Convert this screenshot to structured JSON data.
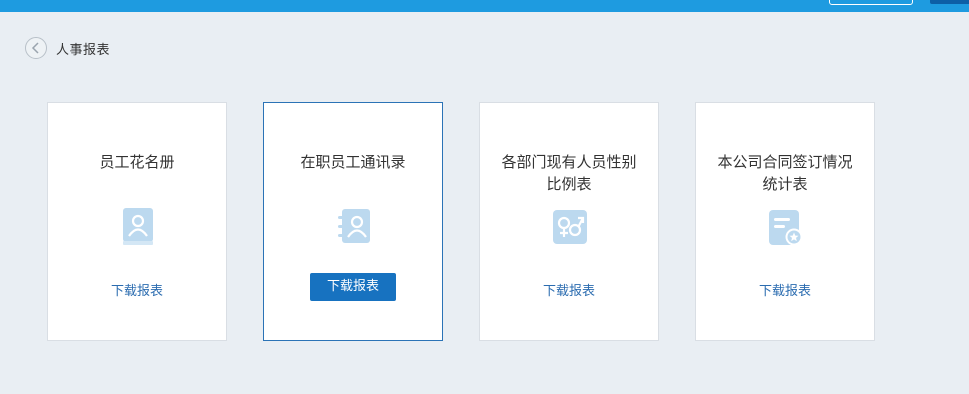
{
  "breadcrumb": {
    "title": "人事报表",
    "back_icon": "back-circle-icon"
  },
  "colors": {
    "topbar": "#1e9be0",
    "accent": "#1772c0",
    "link": "#2b6cb0",
    "icon": "#bcd9ef"
  },
  "cards": [
    {
      "title": "员工花名册",
      "icon": "contact-book-icon",
      "action": "下载报表",
      "selected": false
    },
    {
      "title": "在职员工通讯录",
      "icon": "address-book-icon",
      "action": "下载报表",
      "selected": true
    },
    {
      "title": "各部门现有人员性别比例表",
      "icon": "gender-ratio-icon",
      "action": "下载报表",
      "selected": false
    },
    {
      "title": "本公司合同签订情况统计表",
      "icon": "contract-stats-icon",
      "action": "下载报表",
      "selected": false
    }
  ]
}
